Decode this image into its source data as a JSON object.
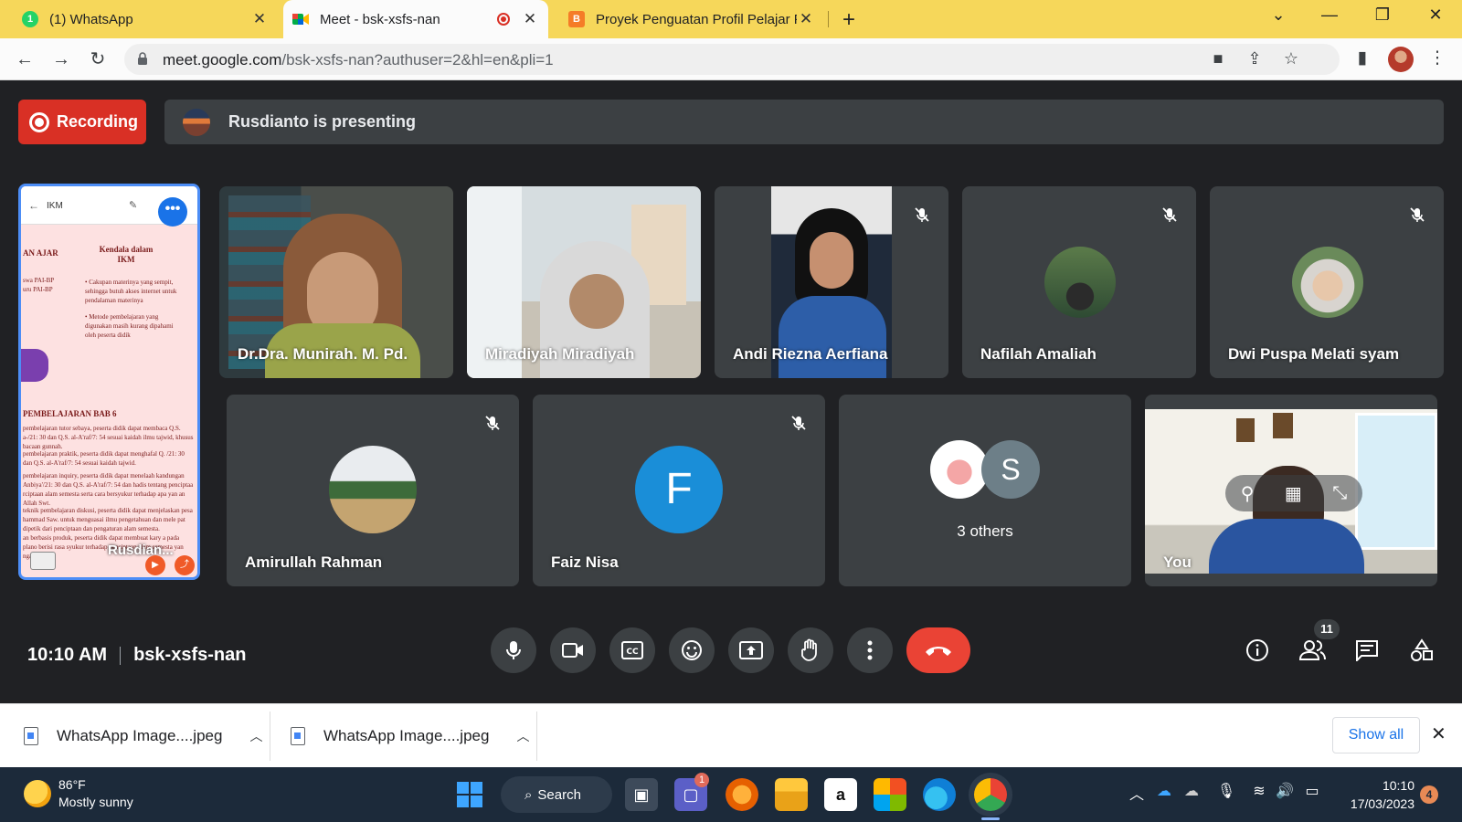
{
  "browser": {
    "tabs": [
      {
        "label": "(1) WhatsApp",
        "badge": "1"
      },
      {
        "label": "Meet - bsk-xsfs-nan"
      },
      {
        "label": "Proyek Penguatan Profil Pelajar P"
      }
    ],
    "url_host": "meet.google.com",
    "url_path": "/bsk-xsfs-nan?authuser=2&hl=en&pli=1"
  },
  "meet": {
    "recording_label": "Recording",
    "presenting_text": "Rusdianto is presenting",
    "share": {
      "app_title": "IKM",
      "heading1": "Kendala dalam IKM",
      "left_frag": "AN AJAR",
      "left_lines": [
        "swa PAI-BP",
        "uru PAI-BP"
      ],
      "bullet1": "• Cakupan materinya yang sempit, sehingga butuh akses internet untuk pendalaman materinya",
      "bullet2": "• Metode pembelajaran yang digunakan masih kurang dipahami oleh peserta didik",
      "heading2": "PEMBELAJARAN BAB 6",
      "para1": "pembelajaran tutor sebaya, peserta didik dapat membaca Q.S. a-/21: 30 dan Q.S. al-A'raf/7: 54 sesuai kaidah ilmu tajwid, khusus bacaan gunnah.",
      "para2": "pembelajaran praktik, peserta didik dapat menghafal Q. /21: 30 dan Q.S. al-A'raf/7: 54 sesuai kaidah tajwid.",
      "para3": "pembelajaran inquiry, peserta didik dapat menelaah kandungan Anbiya'/21: 30 dan Q.S. al-A'raf/7: 54 dan hadis tentang penciptaa rciptaan alam semesta serta cara bersyukur terhadap apa yan an Allah Swt.",
      "para4": "teknik pembelajaran diskusi, peserta didik dapat menjelaskan pesa hammad Saw. untuk menguasai ilmu pengetahuan dan mele pat dipetik dari penciptaan dan pengaturan alam semesta.",
      "para5": "an berbasis produk, peserta didik dapat membuat kary a pada plano berisi rasa syukur terhadap penciptaan alam semesta yan ngan benar.",
      "presenter_label": "Rusdian..."
    },
    "participants_row1": [
      {
        "name": "Dr.Dra. Munirah. M. Pd."
      },
      {
        "name": "Miradiyah Miradiyah"
      },
      {
        "name": "Andi Riezna Aerfiana"
      },
      {
        "name": "Nafilah Amaliah"
      },
      {
        "name": "Dwi Puspa Melati syam"
      }
    ],
    "participants_row2": [
      {
        "name": "Amirullah Rahman"
      },
      {
        "name": "Faiz Nisa",
        "initial": "F",
        "color": "#1a8ed8"
      },
      {
        "name": "3 others",
        "initial": "S",
        "color": "#6d7f88"
      },
      {
        "name": "You"
      }
    ],
    "time": "10:10 AM",
    "meeting_code": "bsk-xsfs-nan",
    "people_count": "11"
  },
  "downloads": {
    "items": [
      "WhatsApp Image....jpeg",
      "WhatsApp Image....jpeg"
    ],
    "show_all": "Show all"
  },
  "taskbar": {
    "temp": "86°F",
    "weather": "Mostly sunny",
    "search": "Search",
    "teams_badge": "1",
    "time": "10:10",
    "date": "17/03/2023",
    "notifications": "4"
  }
}
